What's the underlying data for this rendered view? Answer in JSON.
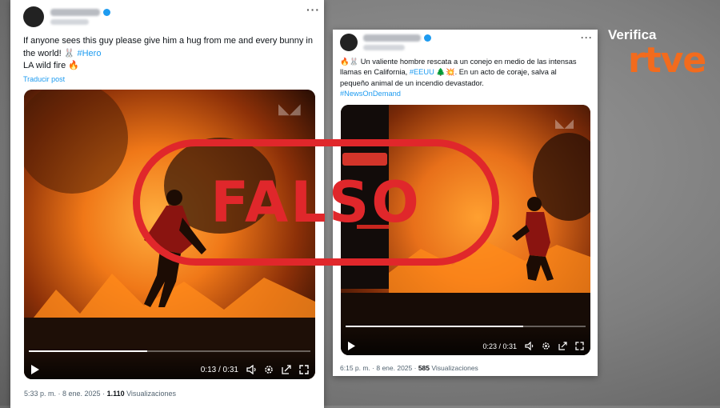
{
  "brand": {
    "verifica": "Verifica",
    "rtve": "rtve",
    "accent": "#f26b1d"
  },
  "stamp": {
    "label": "FALSO",
    "color": "#e0272b"
  },
  "tweet1": {
    "line1": "If anyone sees this guy please give him a hug from me and every bunny in",
    "line2": "the world! 🐰 ",
    "hashtag": "#Hero",
    "line3": "LA wild fire 🔥",
    "translate": "Traducir post",
    "time_display": "0:13 / 0:31",
    "progress": 0.42,
    "timestamp": "5:33 p. m. · 8 ene. 2025 · ",
    "views_count": "1.110",
    "views_label": " Visualizaciones"
  },
  "tweet2": {
    "line1": "🔥🐰 Un valiente hombre rescata a un conejo en medio de las intensas",
    "line2_start": "llamas en California, ",
    "hashtag_eeuu": "#EEUU",
    "line2_end": " 🌲💥. En un acto de coraje, salva al",
    "line3": "pequeño animal de un incendio devastador.",
    "hashtag_news": "#NewsOnDemand",
    "time_display": "0:23 / 0:31",
    "progress": 0.74,
    "timestamp": "6:15 p. m. · 8 ene. 2025 · ",
    "views_count": "585",
    "views_label": " Visualizaciones"
  },
  "icons": [
    "more-icon",
    "verified-icon",
    "play-icon",
    "volume-icon",
    "settings-icon",
    "share-icon",
    "fullscreen-icon"
  ]
}
